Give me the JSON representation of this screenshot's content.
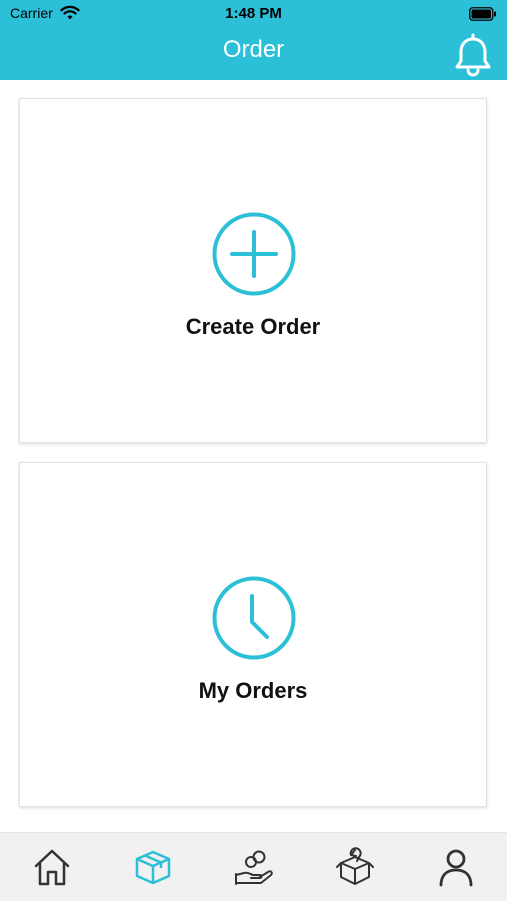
{
  "status_bar": {
    "carrier": "Carrier",
    "time": "1:48 PM"
  },
  "header": {
    "title": "Order"
  },
  "cards": [
    {
      "label": "Create Order",
      "icon": "plus-circle-icon"
    },
    {
      "label": "My Orders",
      "icon": "clock-icon"
    }
  ],
  "tabbar": {
    "items": [
      {
        "icon": "home-icon",
        "active": false
      },
      {
        "icon": "package-icon",
        "active": true
      },
      {
        "icon": "hand-money-icon",
        "active": false
      },
      {
        "icon": "box-return-icon",
        "active": false
      },
      {
        "icon": "user-icon",
        "active": false
      }
    ]
  },
  "colors": {
    "accent": "#2bbfd8",
    "text": "#111111",
    "tab_inactive": "#333333"
  }
}
